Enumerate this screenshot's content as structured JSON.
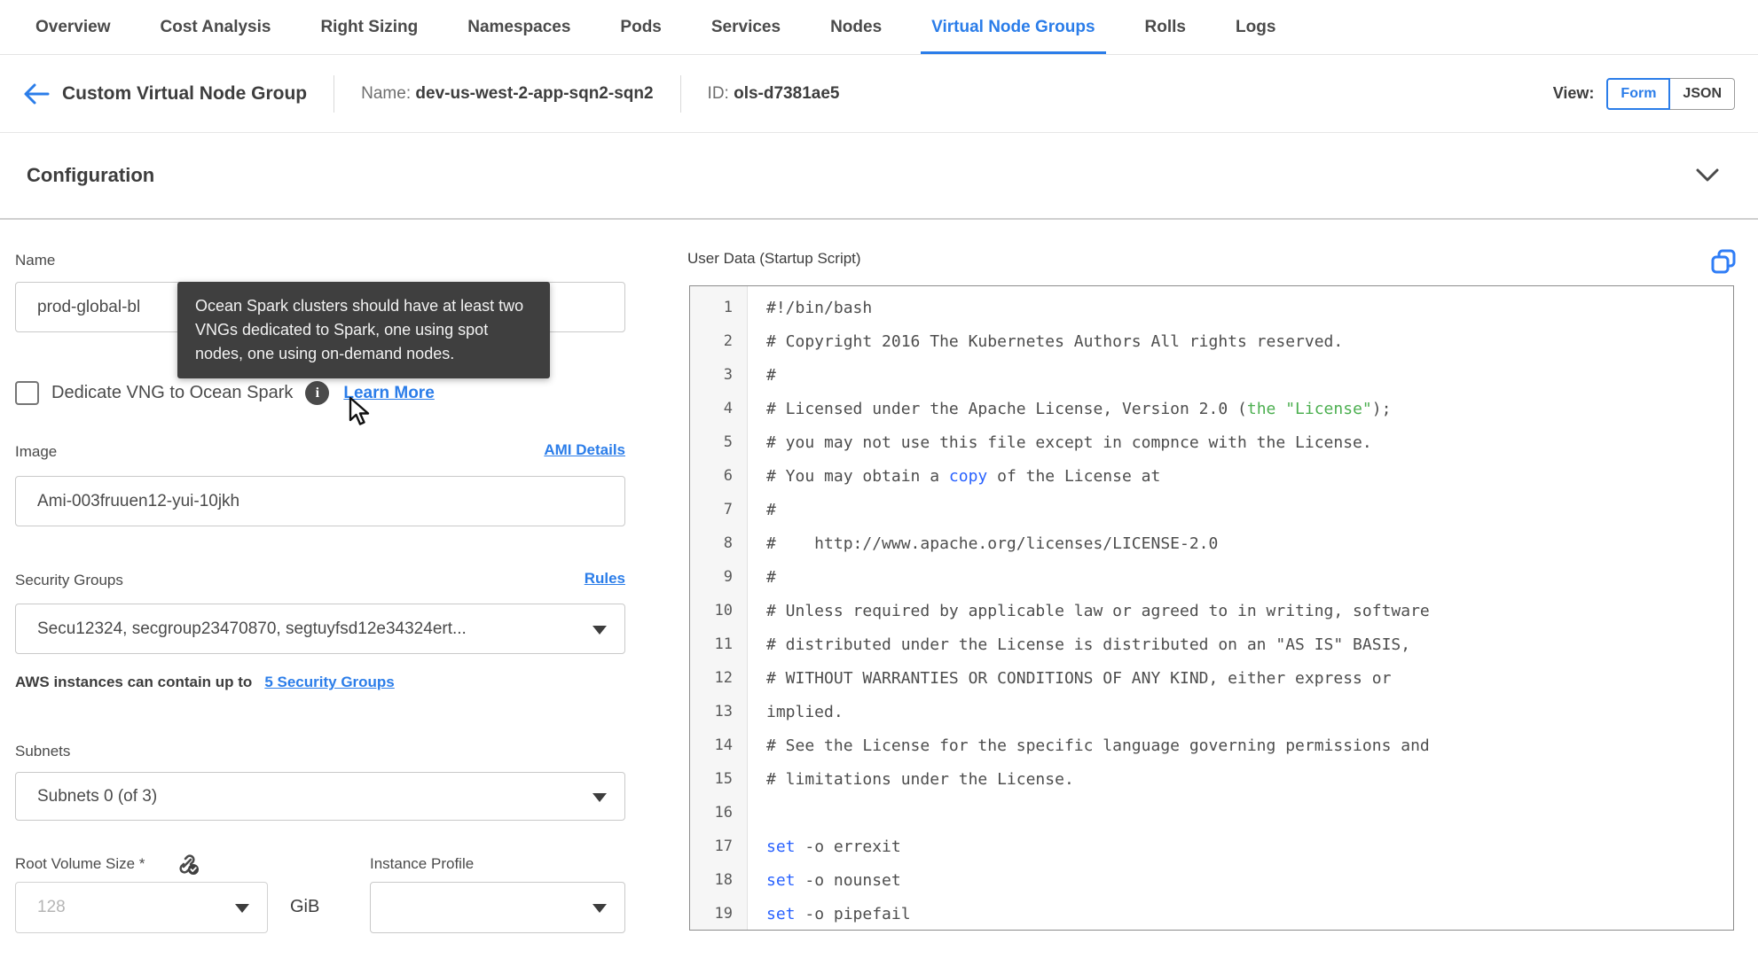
{
  "colors": {
    "accent_blue": "#2b7de9",
    "link_blue": "#2b7de9",
    "code_green": "#4caf50",
    "code_blue": "#2962ff",
    "tooltip_bg": "#3f3f3f"
  },
  "tabs": [
    {
      "label": "Overview",
      "active": false
    },
    {
      "label": "Cost Analysis",
      "active": false
    },
    {
      "label": "Right Sizing",
      "active": false
    },
    {
      "label": "Namespaces",
      "active": false
    },
    {
      "label": "Pods",
      "active": false
    },
    {
      "label": "Services",
      "active": false
    },
    {
      "label": "Nodes",
      "active": false
    },
    {
      "label": "Virtual Node Groups",
      "active": true
    },
    {
      "label": "Rolls",
      "active": false
    },
    {
      "label": "Logs",
      "active": false
    }
  ],
  "header": {
    "title": "Custom Virtual Node Group",
    "name_label": "Name:",
    "name_value": "dev-us-west-2-app-sqn2-sqn2",
    "id_label": "ID:",
    "id_value": "ols-d7381ae5",
    "view_label": "View:",
    "view_form": "Form",
    "view_json": "JSON",
    "view_active": "Form"
  },
  "section": {
    "title": "Configuration"
  },
  "form": {
    "name": {
      "label": "Name",
      "value": "prod-global-bl"
    },
    "tooltip": {
      "text": "Ocean Spark clusters should have at least two VNGs dedicated to Spark, one using spot nodes, one using on-demand nodes."
    },
    "dedicate": {
      "label": "Dedicate VNG to Ocean Spark",
      "info_icon": "i",
      "link": "Learn More"
    },
    "image": {
      "label": "Image",
      "link": "AMI Details",
      "value": "Ami-003fruuen12-yui-10jkh"
    },
    "security_groups": {
      "label": "Security Groups",
      "link": "Rules",
      "value": "Secu12324, secgroup23470870, segtuyfsd12e34324ert...",
      "note_text": "AWS instances can contain up to",
      "note_link": "5 Security Groups"
    },
    "subnets": {
      "label": "Subnets",
      "value": "Subnets 0 (of 3)"
    },
    "root_volume": {
      "label": "Root Volume Size *",
      "placeholder": "128",
      "unit": "GiB"
    },
    "instance_profile": {
      "label": "Instance Profile",
      "value": ""
    }
  },
  "editor": {
    "title": "User Data (Startup Script)",
    "lines": [
      {
        "n": "1",
        "segs": [
          [
            "d",
            "#!/bin/bash"
          ]
        ]
      },
      {
        "n": "2",
        "segs": [
          [
            "d",
            "# Copyright 2016 The Kubernetes Authors All rights reserved."
          ]
        ]
      },
      {
        "n": "3",
        "segs": [
          [
            "d",
            "#"
          ]
        ]
      },
      {
        "n": "4",
        "segs": [
          [
            "d",
            "# Licensed under the Apache License, Version 2.0 ("
          ],
          [
            "g",
            "the \"License\""
          ],
          [
            "d",
            ");"
          ]
        ]
      },
      {
        "n": "5",
        "segs": [
          [
            "d",
            "# you may not use this file except in compnce with the License."
          ]
        ]
      },
      {
        "n": "6",
        "segs": [
          [
            "d",
            "# You may obtain a "
          ],
          [
            "b",
            "copy"
          ],
          [
            "d",
            " of the License at"
          ]
        ]
      },
      {
        "n": "7",
        "segs": [
          [
            "d",
            "#"
          ]
        ]
      },
      {
        "n": "8",
        "segs": [
          [
            "d",
            "#    http://www.apache.org/licenses/LICENSE-2.0"
          ]
        ]
      },
      {
        "n": "9",
        "segs": [
          [
            "d",
            "#"
          ]
        ]
      },
      {
        "n": "10",
        "segs": [
          [
            "d",
            "# Unless required by applicable law or agreed to in writing, software"
          ]
        ]
      },
      {
        "n": "11",
        "segs": [
          [
            "d",
            "# distributed under the License is distributed on an \"AS IS\" BASIS,"
          ]
        ]
      },
      {
        "n": "12",
        "segs": [
          [
            "d",
            "# WITHOUT WARRANTIES OR CONDITIONS OF ANY KIND, either express or"
          ]
        ]
      },
      {
        "n": "13",
        "segs": [
          [
            "d",
            "implied."
          ]
        ]
      },
      {
        "n": "14",
        "segs": [
          [
            "d",
            "# See the License for the specific language governing permissions and"
          ]
        ]
      },
      {
        "n": "15",
        "segs": [
          [
            "d",
            "# limitations under the License."
          ]
        ]
      },
      {
        "n": "16",
        "segs": []
      },
      {
        "n": "17",
        "segs": [
          [
            "b",
            "set"
          ],
          [
            "d",
            " -o errexit"
          ]
        ]
      },
      {
        "n": "18",
        "segs": [
          [
            "b",
            "set"
          ],
          [
            "d",
            " -o nounset"
          ]
        ]
      },
      {
        "n": "19",
        "segs": [
          [
            "b",
            "set"
          ],
          [
            "d",
            " -o pipefail"
          ]
        ]
      }
    ]
  }
}
